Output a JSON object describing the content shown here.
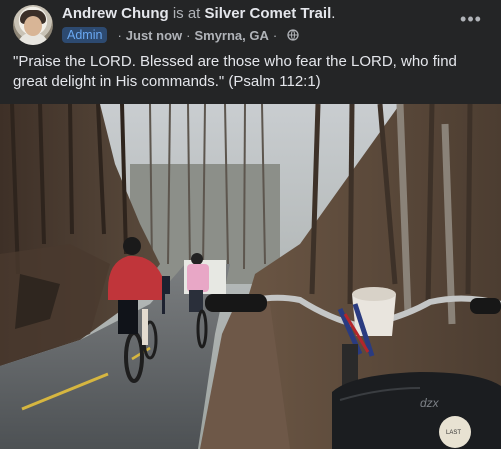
{
  "post": {
    "author": "Andrew Chung",
    "at_text": " is at ",
    "place": "Silver Comet Trail",
    "period": ".",
    "badge": "Admin",
    "sep1": "·",
    "time": "Just now",
    "sep2": "·",
    "location": "Smyrna, GA",
    "sep3": "·",
    "caption": "\"Praise the LORD. Blessed are those who fear the LORD, who find great delight in His commands.\" (Psalm 112:1)",
    "more_label": "•••"
  },
  "icons": {
    "privacy": "globe-icon",
    "more": "more-options-icon"
  },
  "photo_text": {
    "bag_logo": "dzx",
    "sticker": "LAST"
  },
  "colors": {
    "background": "#242526",
    "text": "#e4e6eb",
    "secondary": "#b0b3b8",
    "badge_bg": "#2d4a70",
    "badge_text": "#6aa8f2"
  }
}
